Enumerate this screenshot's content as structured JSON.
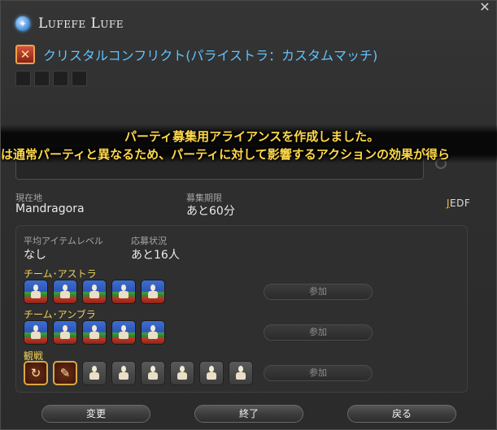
{
  "header": {
    "player_name": "Lufefe Lufe",
    "crystal_icon": "crystal-icon",
    "close_glyph": "✕"
  },
  "duty": {
    "name": "クリスタルコンフリクト(パライストラ：カスタムマッチ)",
    "icon": "crossed-swords-icon"
  },
  "notification": {
    "line1": "パーティ募集用アライアンスを作成しました。",
    "line2": "は通常パーティと異なるため、パーティに対して影響するアクションの効果が得ら"
  },
  "info": {
    "location_label": "現在地",
    "location_value": "Mandragora",
    "deadline_label": "募集期限",
    "deadline_value": "あと60分",
    "languages": "JEDF",
    "avg_item_level_label": "平均アイテムレベル",
    "avg_item_level_value": "なし",
    "status_label": "応募状況",
    "status_value": "あと16人"
  },
  "teams": [
    {
      "label": "チーム･アストラ",
      "join_label": "参加",
      "slots": 5
    },
    {
      "label": "チーム･アンブラ",
      "join_label": "参加",
      "slots": 5
    },
    {
      "label": "観戦",
      "join_label": "参加",
      "slots": 8
    }
  ],
  "buttons": {
    "change": "変更",
    "end": "終了",
    "back": "戻る"
  },
  "colors": {
    "accent_blue": "#5fc3ff",
    "notice_yellow": "#ffd84a",
    "team_label": "#f0d15a"
  }
}
